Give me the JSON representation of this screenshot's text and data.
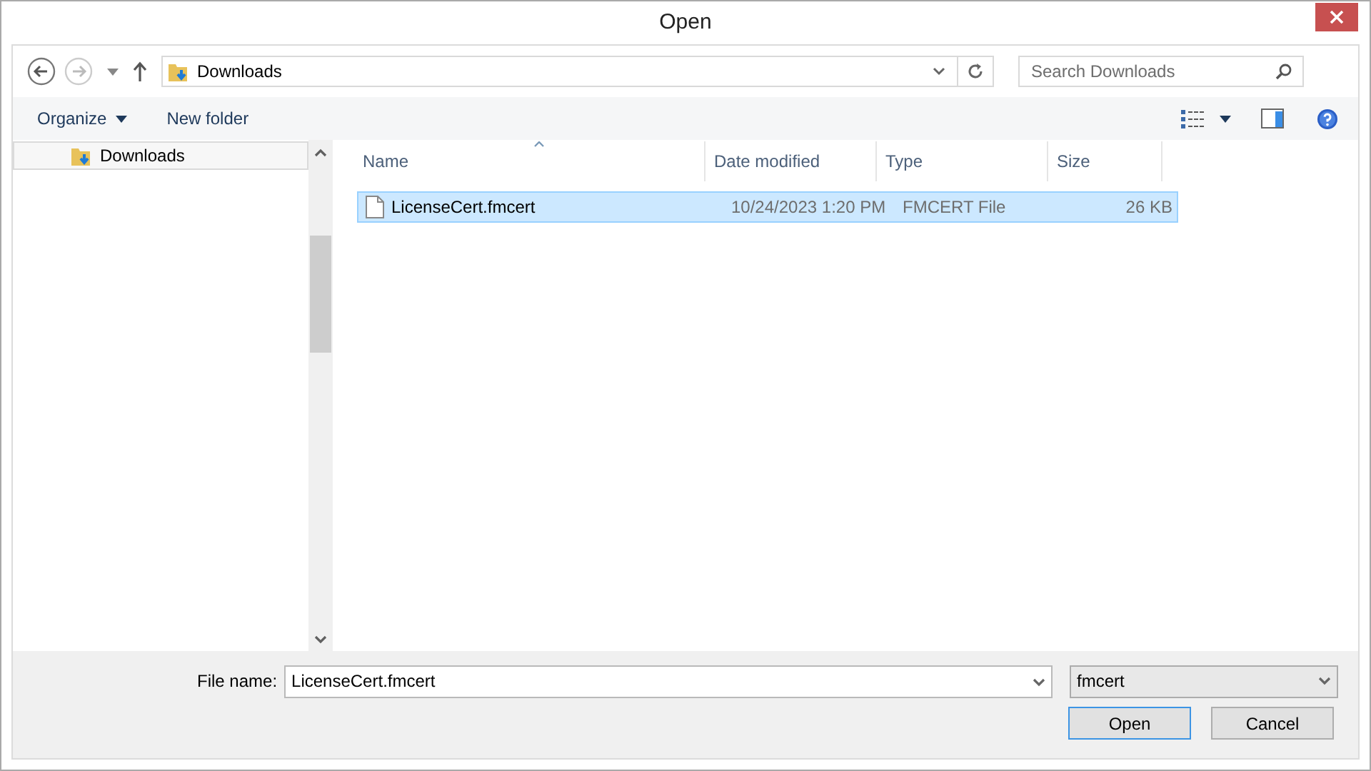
{
  "window": {
    "title": "Open"
  },
  "address": {
    "location": "Downloads"
  },
  "search": {
    "placeholder": "Search Downloads"
  },
  "toolbar": {
    "organize": "Organize",
    "new_folder": "New folder"
  },
  "sidebar": {
    "items": [
      {
        "label": "Downloads",
        "selected": true
      }
    ]
  },
  "table": {
    "columns": [
      "Name",
      "Date modified",
      "Type",
      "Size"
    ],
    "rows": [
      {
        "name": "LicenseCert.fmcert",
        "date": "10/24/2023 1:20 PM",
        "type": "FMCERT File",
        "size": "26 KB",
        "selected": true
      }
    ]
  },
  "file_name": {
    "label": "File name:",
    "value": "LicenseCert.fmcert"
  },
  "file_type": {
    "value": "fmcert"
  },
  "buttons": [
    {
      "label": "Open",
      "kind": "default"
    },
    {
      "label": "Cancel",
      "kind": "normal"
    }
  ]
}
